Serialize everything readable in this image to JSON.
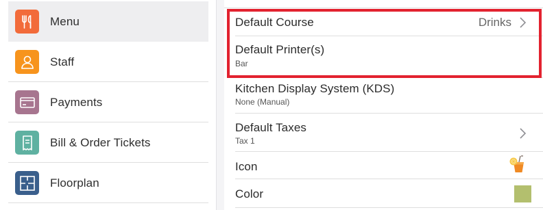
{
  "sidebar": {
    "items": [
      {
        "label": "Menu",
        "icon": "fork-knife-icon",
        "color": "#f26b3a",
        "active": true
      },
      {
        "label": "Staff",
        "icon": "person-icon",
        "color": "#f7941d"
      },
      {
        "label": "Payments",
        "icon": "card-icon",
        "color": "#a7758f"
      },
      {
        "label": "Bill & Order Tickets",
        "icon": "receipt-icon",
        "color": "#5fb1a1"
      },
      {
        "label": "Floorplan",
        "icon": "floorplan-icon",
        "color": "#3a5f8c"
      }
    ]
  },
  "settings": {
    "default_course": {
      "title": "Default Course",
      "value": "Drinks"
    },
    "default_printers": {
      "title": "Default Printer(s)",
      "subtitle": "Bar"
    },
    "kds": {
      "title": "Kitchen Display System (KDS)",
      "subtitle": "None (Manual)"
    },
    "default_taxes": {
      "title": "Default Taxes",
      "subtitle": "Tax 1"
    },
    "icon": {
      "title": "Icon",
      "icon": "drink-icon"
    },
    "color": {
      "title": "Color",
      "swatch": "#b3bf6e"
    }
  },
  "colors": {
    "highlight": "#e2222f",
    "active_bg": "#eeeef0"
  }
}
